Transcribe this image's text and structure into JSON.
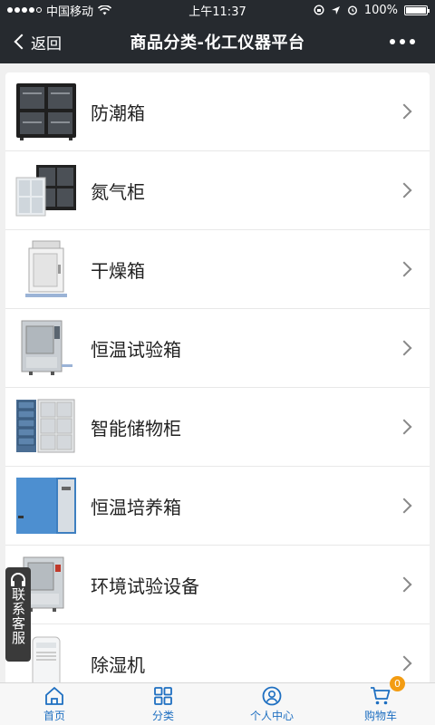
{
  "status_bar": {
    "carrier": "中国移动",
    "time": "上午11:37",
    "battery": "100%",
    "signal_strength": 0.8,
    "battery_level": 1.0
  },
  "nav": {
    "back_label": "返回",
    "title": "商品分类-化工仪器平台"
  },
  "categories": [
    {
      "label": "防潮箱",
      "icon": "dry-cabinet-black"
    },
    {
      "label": "氮气柜",
      "icon": "nitrogen-cabinet"
    },
    {
      "label": "干燥箱",
      "icon": "drying-oven"
    },
    {
      "label": "恒温试验箱",
      "icon": "constant-temp-chamber"
    },
    {
      "label": "智能储物柜",
      "icon": "smart-locker"
    },
    {
      "label": "恒温培养箱",
      "icon": "incubator"
    },
    {
      "label": "环境试验设备",
      "icon": "environmental-chamber"
    },
    {
      "label": "除湿机",
      "icon": "dehumidifier"
    }
  ],
  "customer_service": {
    "label": "联系客服"
  },
  "tab_bar": {
    "accent_color": "#1e6fc1",
    "badge_color": "#f39c12",
    "tabs": [
      {
        "label": "首页",
        "icon": "home-icon"
      },
      {
        "label": "分类",
        "icon": "grid-icon"
      },
      {
        "label": "个人中心",
        "icon": "user-icon"
      },
      {
        "label": "购物车",
        "icon": "cart-icon"
      }
    ],
    "cart_count": "0"
  }
}
